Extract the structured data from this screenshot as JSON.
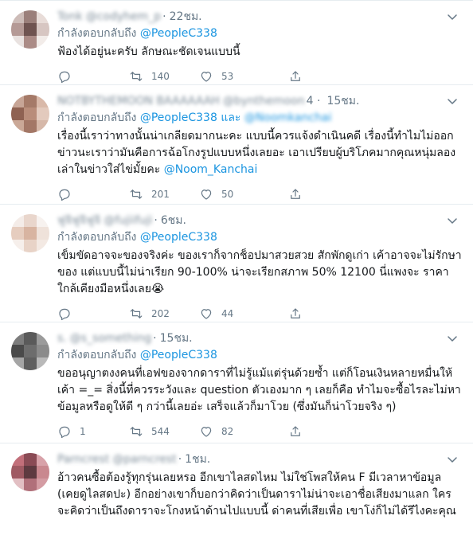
{
  "tweets": [
    {
      "name": "Tonk",
      "handle": "@codyhem_p",
      "time": "22ชม.",
      "reply_prefix": "กำลังตอบกลับถึง",
      "reply_handles": "@PeopleC338",
      "reply_extra": "",
      "body": "ฟ้องได้อยู่นะครับ ลักษณะชัดเจนแบบนี้",
      "mention": "",
      "replies": "",
      "retweets": "140",
      "likes": "53",
      "avatar_colors": [
        "#cdbcb8",
        "#9b7f7a",
        "#e8dcd8",
        "#b59a96",
        "#6f5350",
        "#d7c6c2",
        "#e9e2e0",
        "#ab8b86",
        "#f2ece9"
      ]
    },
    {
      "name": "NOTBYTHEMOON BAAAAAAH",
      "handle": "@bynthemoon",
      "time": "15ชม.",
      "time_prefix": "4 ·",
      "reply_prefix": "กำลังตอบกลับถึง",
      "reply_handles": "@PeopleC338 และ",
      "reply_extra": "@Noomkanchai",
      "body": "เรื่องนี้เราว่าทางนั้นน่าเกลียดมากนะคะ แบบนี้ควรแจ้งดำเนินคดี เรื่องนี้ทำไมไม่ออกข่าวนะเราว่ามันคือการฉ้อโกงรูปแบบหนึ่งเลยอะ เอาเปรียบผู้บริโภคมากคุณหนุ่มลองเล่าในข่าวใส่ไข่มั้ยคะ ",
      "mention": "@Noom_Kanchai",
      "replies": "",
      "retweets": "201",
      "likes": "50",
      "avatar_colors": [
        "#c7a596",
        "#a57a68",
        "#d9b9a9",
        "#8f6252",
        "#b98d7a",
        "#e3cabd",
        "#caa897",
        "#a37766",
        "#d6b8a9"
      ]
    },
    {
      "name": "ฟูจิฟูจิฟูจิ",
      "handle": "@fujiifuji",
      "time": "6ชม.",
      "reply_prefix": "กำลังตอบกลับถึง",
      "reply_handles": "@PeopleC338",
      "reply_extra": "",
      "body": "เข็มขัดอาจจะของจริงค่ะ ของเราก็จากช็อปมาสวยสวย สักพักดูเก่า เค้าอาจจะไม่รักษาของ แต่แบบนี้ไม่น่าเรียก 90-100% น่าจะเรียกสภาพ 50% 12100 นี่แพงจะ ราคาใกล้เคียงมือหนึ่งเลย😭",
      "mention": "",
      "replies": "",
      "retweets": "202",
      "likes": "44",
      "avatar_colors": [
        "#f4ece8",
        "#e9d6cc",
        "#f7f2ef",
        "#e6cdbf",
        "#d8b4a1",
        "#efe2da",
        "#f6efeb",
        "#e8d3c7",
        "#f3e9e3"
      ]
    },
    {
      "name": "s.",
      "handle": "@s_something",
      "time": "15ชม.",
      "reply_prefix": "กำลังตอบกลับถึง",
      "reply_handles": "@PeopleC338",
      "reply_extra": "",
      "body": "ขออนุญาตงงคนที่เอฟของจากดาราที่ไม่รู้แม้แต่รุ่นด้วยซ้ำ แต่ก็โอนเงินหลายหมื่นให้เค้า =_= สิ่งนี้ที่ควรระวังและ question ตัวเองมาก ๆ เลยก็คือ ทำไมจะซื้อไรละไม่หาข้อมูลหรือดูให้ดี ๆ กว่านี้เลยอ่ะ เสร็จแล้วก็มาโวย (ซึ่งมันก็น่าโวยจริง ๆ)",
      "mention": "",
      "replies": "1",
      "retweets": "544",
      "likes": "82",
      "avatar_colors": [
        "#7d7d7d",
        "#5a5a5a",
        "#9b9b9b",
        "#4a4a4a",
        "#6d6d6d",
        "#8b8b8b",
        "#a5a5a5",
        "#5f5f5f",
        "#b9b9b9"
      ]
    },
    {
      "name": "Parncrest",
      "handle": "@parncrest",
      "time": "1ชม.",
      "reply_prefix": "",
      "reply_handles": "",
      "reply_extra": "",
      "body": "อ้าวคนซื้อต้องรู้ทุกรุ่นเลยหรอ อีกเขาไลสดไหม ไม่ใช่โพสให้คน F มีเวลาหาข้อมูล (เคยดูไลสดปะ) อีกอย่างเขาก็บอกว่าคิดว่าเป็นดาราไม่น่าจะเอาชื่อเสียงมาแลก ใครจะคิดว่าเป็นถึงดาราจะโกงหน้าด้านไปแบบนี้ ด่าคนที่เสียเพื่อ เขาโง่ก็ไม่ได้รึไงคะคุณ",
      "mention": "",
      "replies": "",
      "retweets": "",
      "likes": "",
      "avatar_colors": [
        "#c26f7a",
        "#8a4b55",
        "#d8a2a9",
        "#9f5a63",
        "#5e3a40",
        "#c9888f",
        "#e2bfc3",
        "#b1707a",
        "#d49ca3"
      ]
    }
  ]
}
